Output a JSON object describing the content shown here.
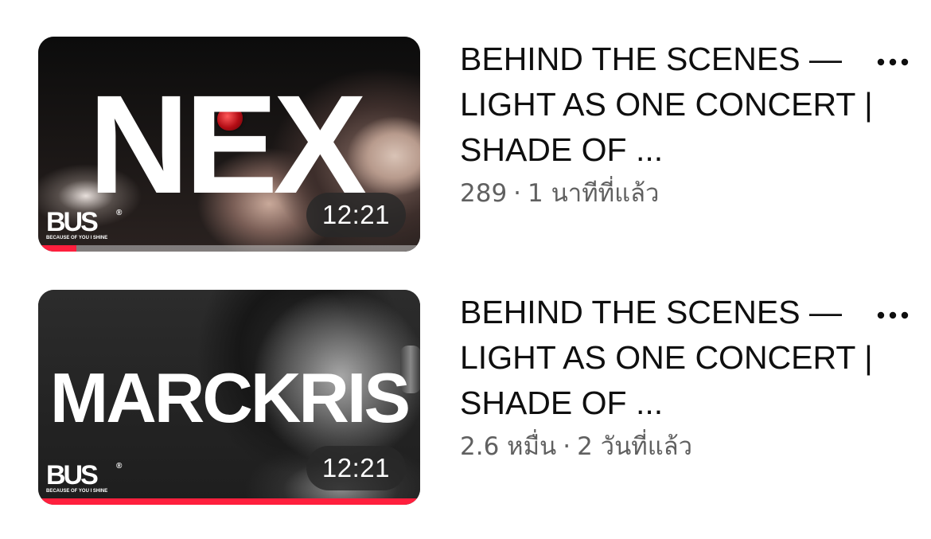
{
  "videos": [
    {
      "thumbnail_text": "NEX",
      "logo_text": "BUS",
      "logo_reg": "®",
      "logo_tagline": "BECAUSE OF YOU I SHINE",
      "duration": "12:21",
      "progress": 0.1,
      "title": "BEHIND THE SCENES — LIGHT AS ONE CONCERT | SHADE OF ...",
      "views": "289",
      "separator": "·",
      "age": "1 นาทีที่แล้ว",
      "more_icon": "more-vertical-icon"
    },
    {
      "thumbnail_text": "MARCKRIS",
      "logo_text": "BUS",
      "logo_reg": "®",
      "logo_tagline": "BECAUSE OF YOU I SHINE",
      "duration": "12:21",
      "progress": 1.0,
      "title": "BEHIND THE SCENES — LIGHT AS ONE CONCERT | SHADE OF ...",
      "views": "2.6 หมื่น",
      "separator": "·",
      "age": "2 วันที่แล้ว",
      "more_icon": "more-vertical-icon"
    }
  ],
  "colors": {
    "progress": "#ff1f3d",
    "title_text": "#0f0f0f",
    "meta_text": "#606060"
  }
}
